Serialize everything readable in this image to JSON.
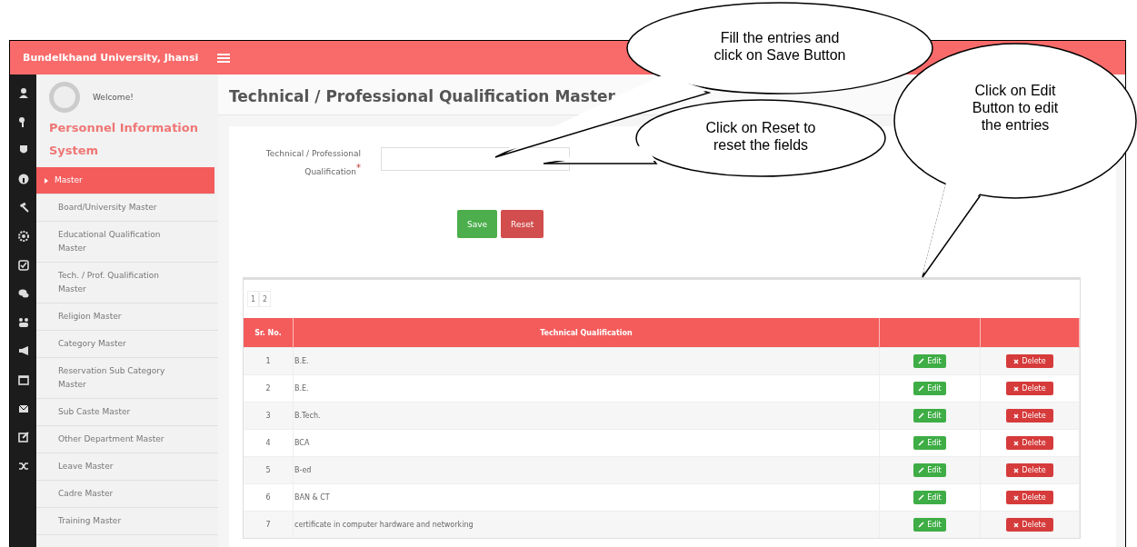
{
  "header": {
    "title": "Bundelkhand University, Jhansi"
  },
  "sidebar": {
    "welcome": "Welcome!",
    "app_name": "Personnel Information System",
    "items": [
      {
        "label": "Master",
        "selected": true
      },
      {
        "label": "Board/University Master",
        "selected": false
      },
      {
        "label": "Educational Qualification Master",
        "selected": false
      },
      {
        "label": "Tech. / Prof. Qualification Master",
        "selected": false
      },
      {
        "label": "Religion Master",
        "selected": false
      },
      {
        "label": "Category Master",
        "selected": false
      },
      {
        "label": "Reservation Sub Category Master",
        "selected": false
      },
      {
        "label": "Sub Caste Master",
        "selected": false
      },
      {
        "label": "Other Department Master",
        "selected": false
      },
      {
        "label": "Leave Master",
        "selected": false
      },
      {
        "label": "Cadre Master",
        "selected": false
      },
      {
        "label": "Training Master",
        "selected": false
      }
    ]
  },
  "page_title": "Technical / Professional Qualification Master",
  "form": {
    "label": "Technical / Professional Qualification",
    "required_mark": "*",
    "buttons": [
      "Save",
      "Reset"
    ]
  },
  "table": {
    "pagination": [
      "1",
      "2"
    ],
    "columns": [
      "Sr. No.",
      "Technical Qualification"
    ],
    "rows": [
      {
        "sr": "1",
        "qualification": "B.E.",
        "edit": "Edit",
        "delete": "Delete"
      },
      {
        "sr": "2",
        "qualification": "B.E.",
        "edit": "Edit",
        "delete": "Delete"
      },
      {
        "sr": "3",
        "qualification": "B.Tech.",
        "edit": "Edit",
        "delete": "Delete"
      },
      {
        "sr": "4",
        "qualification": "BCA",
        "edit": "Edit",
        "delete": "Delete"
      },
      {
        "sr": "5",
        "qualification": "B-ed",
        "edit": "Edit",
        "delete": "Delete"
      },
      {
        "sr": "6",
        "qualification": "BAN & CT",
        "edit": "Edit",
        "delete": "Delete"
      },
      {
        "sr": "7",
        "qualification": "certificate in computer hardware and networking",
        "edit": "Edit",
        "delete": "Delete"
      }
    ]
  },
  "callouts": [
    {
      "lines": [
        "Fill the entries and",
        "click on Save Button"
      ]
    },
    {
      "lines": [
        "Click on Reset to",
        "reset the fields"
      ]
    },
    {
      "lines": [
        "Click on Edit",
        "Button to edit",
        "the entries"
      ]
    }
  ]
}
